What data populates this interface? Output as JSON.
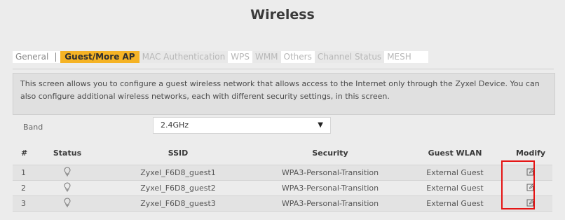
{
  "page": {
    "title": "Wireless"
  },
  "tabs": [
    {
      "label": "General",
      "state": "normal"
    },
    {
      "label": "Guest/More AP",
      "state": "active"
    },
    {
      "label": "MAC Authentication",
      "state": "disabled"
    },
    {
      "label": "WPS",
      "state": "disabled"
    },
    {
      "label": "WMM",
      "state": "disabled"
    },
    {
      "label": "Others",
      "state": "disabled"
    },
    {
      "label": "Channel Status",
      "state": "disabled"
    },
    {
      "label": "MESH",
      "state": "disabled"
    }
  ],
  "info": {
    "text": "This screen allows you to configure a guest wireless network that allows access to the Internet only through the Zyxel Device. You can also configure additional wireless networks, each with different security settings, in this screen."
  },
  "band": {
    "label": "Band",
    "value": "2.4GHz"
  },
  "table": {
    "headers": {
      "num": "#",
      "status": "Status",
      "ssid": "SSID",
      "security": "Security",
      "guest": "Guest WLAN",
      "modify": "Modify"
    },
    "rows": [
      {
        "num": "1",
        "ssid": "Zyxel_F6D8_guest1",
        "security": "WPA3-Personal-Transition",
        "guest": "External Guest"
      },
      {
        "num": "2",
        "ssid": "Zyxel_F6D8_guest2",
        "security": "WPA3-Personal-Transition",
        "guest": "External Guest"
      },
      {
        "num": "3",
        "ssid": "Zyxel_F6D8_guest3",
        "security": "WPA3-Personal-Transition",
        "guest": "External Guest"
      }
    ]
  },
  "icons": {
    "status": "lightbulb-icon",
    "modify": "edit-icon",
    "band_arrow": "caret-down-icon"
  },
  "colors": {
    "active_tab": "#f5b325",
    "highlight": "#e51515"
  }
}
